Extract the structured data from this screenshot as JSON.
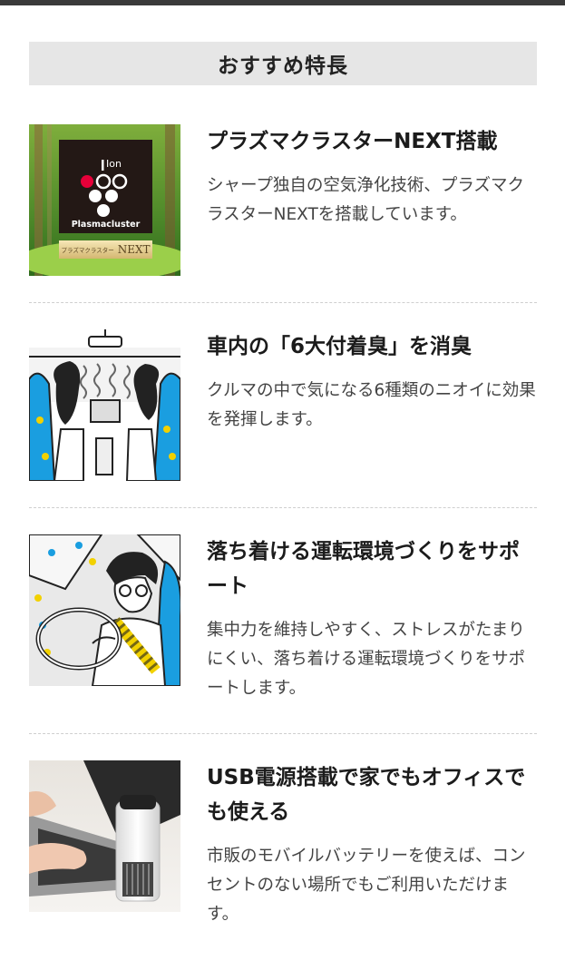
{
  "section": {
    "title": "おすすめ特長"
  },
  "features": [
    {
      "title": "プラズマクラスターNEXT搭載",
      "desc": "シャープ独自の空気浄化技術、プラズマクラスターNEXTを搭載しています。",
      "logo_text": "Plasmacluster",
      "logo_ion": "Ion",
      "badge_jp": "プラズマクラスター",
      "badge_en": "NEXT"
    },
    {
      "title": "車内の「6大付着臭」を消臭",
      "desc": "クルマの中で気になる6種類のニオイに効果を発揮します。"
    },
    {
      "title": "落ち着ける運転環境づくりをサポート",
      "desc": "集中力を維持しやすく、ストレスがたまりにくい、落ち着ける運転環境づくりをサポートします。"
    },
    {
      "title": "USB電源搭載で家でもオフィスでも使える",
      "desc": "市販のモバイルバッテリーを使えば、コンセントのない場所でもご利用いただけます。"
    }
  ],
  "colors": {
    "header_bg": "#e6e6e6",
    "divider": "#cfcfcf",
    "logo_red": "#e60039",
    "seat_blue": "#1a9ee0"
  }
}
